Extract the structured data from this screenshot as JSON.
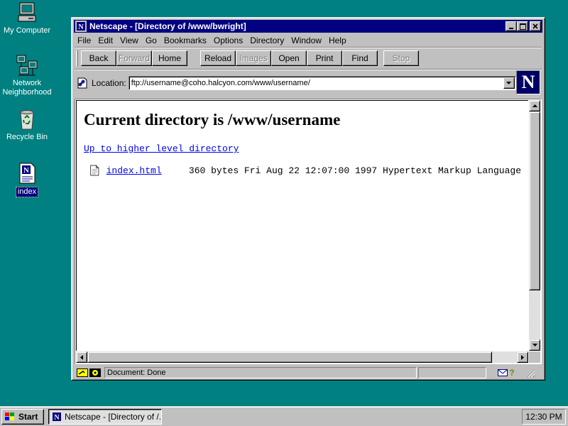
{
  "desktop": {
    "icons": [
      {
        "label": "My Computer"
      },
      {
        "label": "Network Neighborhood"
      },
      {
        "label": "Recycle Bin"
      },
      {
        "label": "index"
      }
    ]
  },
  "window": {
    "title": "Netscape - [Directory of /www/bwright]",
    "menu": [
      "File",
      "Edit",
      "View",
      "Go",
      "Bookmarks",
      "Options",
      "Directory",
      "Window",
      "Help"
    ],
    "toolbar": {
      "back": "Back",
      "forward": "Forward",
      "home": "Home",
      "reload": "Reload",
      "images": "Images",
      "open": "Open",
      "print": "Print",
      "find": "Find",
      "stop": "Stop"
    },
    "location_label": "Location:",
    "location_value": "ftp://username@coho.halcyon.com/www/username/",
    "logo_letter": "N"
  },
  "content": {
    "heading": "Current directory is /www/username",
    "up_link": "Up to higher level directory",
    "files": [
      {
        "name": "index.html",
        "info": "360 bytes Fri Aug 22 12:07:00 1997 Hypertext Markup Language"
      }
    ]
  },
  "status": {
    "text": "Document: Done"
  },
  "taskbar": {
    "start": "Start",
    "task": "Netscape - [Directory of /...",
    "clock": "12:30 PM"
  },
  "colors": {
    "desktop": "#008080",
    "titlebar": "#000080",
    "link": "#0000ee"
  }
}
